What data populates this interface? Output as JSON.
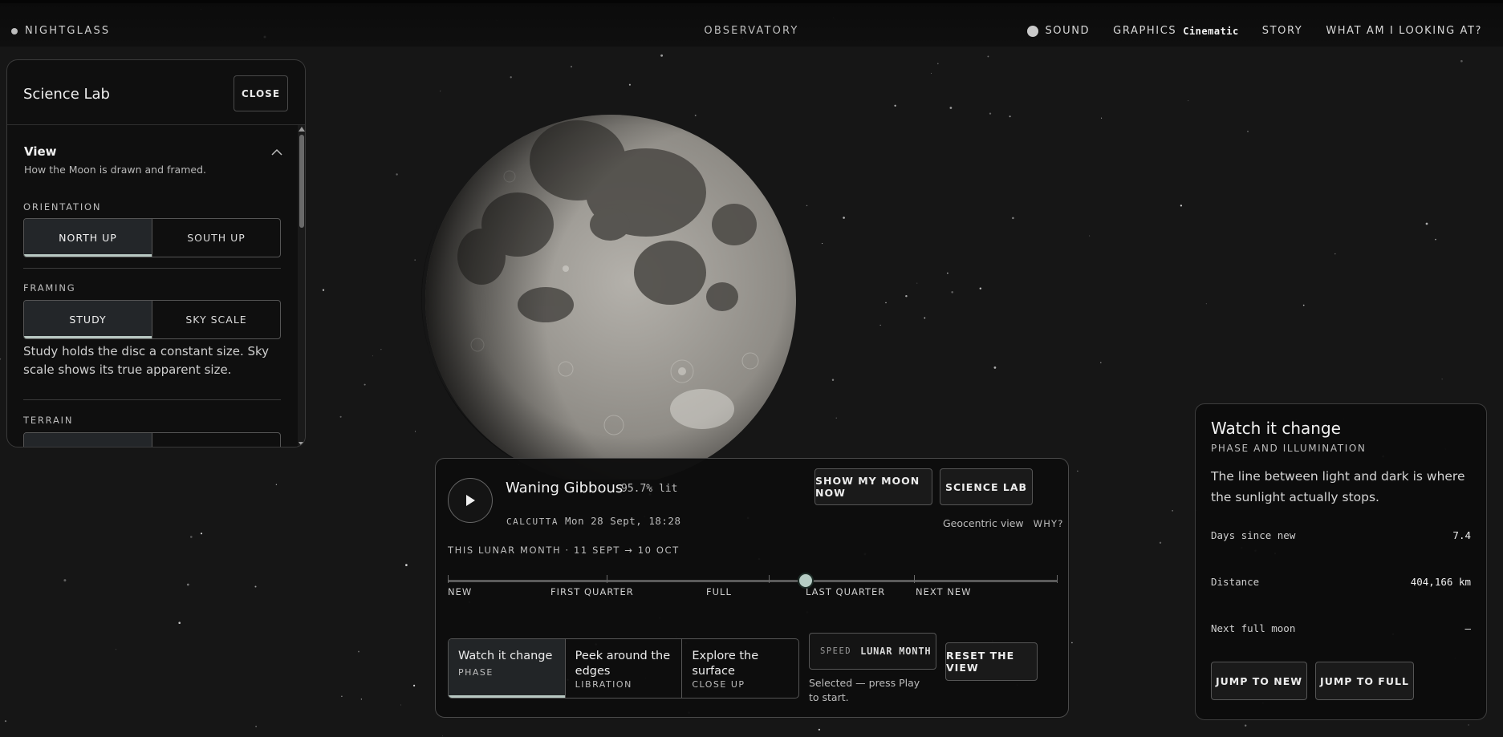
{
  "header": {
    "brand": "NIGHTGLASS",
    "center_title": "OBSERVATORY",
    "nav": {
      "sound": "SOUND",
      "graphics": "GRAPHICS",
      "graphics_value": "Cinematic",
      "story": "STORY",
      "what": "WHAT AM I LOOKING AT?"
    }
  },
  "lab": {
    "title": "Science Lab",
    "close": "CLOSE",
    "section_title": "View",
    "section_sub": "How the Moon is drawn and framed.",
    "orientation_label": "ORIENTATION",
    "orientation_options": [
      "NORTH UP",
      "SOUTH UP"
    ],
    "orientation_selected": "NORTH UP",
    "framing_label": "FRAMING",
    "framing_options": [
      "STUDY",
      "SKY SCALE"
    ],
    "framing_selected": "STUDY",
    "framing_help": "Study holds the disc a constant size. Sky scale shows its true apparent size.",
    "terrain_label": "TERRAIN"
  },
  "moon": {
    "illumination_percent": 95.7,
    "phase": "waning gibbous"
  },
  "controls": {
    "phase_name": "Waning Gibbous",
    "lit": "95.7% lit",
    "city": "CALCUTTA",
    "datetime": "Mon 28 Sept, 18:28",
    "show_moon_btn": "SHOW MY MOON NOW",
    "science_lab_btn": "SCIENCE LAB",
    "geocentric": "Geocentric view",
    "why": "WHY?",
    "month_label": "THIS LUNAR MONTH · 11 SEPT → 10 OCT",
    "timeline": {
      "labels": [
        "NEW",
        "FIRST QUARTER",
        "FULL",
        "LAST QUARTER",
        "NEXT NEW"
      ],
      "position_fraction": 0.587
    },
    "modes": [
      {
        "name": "Watch it change",
        "sub": "PHASE"
      },
      {
        "name": "Peek around the edges",
        "sub": "LIBRATION"
      },
      {
        "name": "Explore the surface",
        "sub": "CLOSE UP"
      }
    ],
    "mode_selected": "Watch it change",
    "speed_key": "SPEED",
    "speed_value": "LUNAR MONTH",
    "speed_help": "Selected — press Play to start.",
    "reset_btn": "RESET THE VIEW"
  },
  "card": {
    "title": "Watch it change",
    "subtitle": "PHASE AND ILLUMINATION",
    "description": "The line between light and dark is where the sunlight actually stops.",
    "rows": [
      {
        "label": "Days since new",
        "value": "7.4"
      },
      {
        "label": "Distance",
        "value": "404,166 km"
      },
      {
        "label": "Next full moon",
        "value": "—"
      }
    ],
    "jump_new": "JUMP TO NEW",
    "jump_full": "JUMP TO FULL"
  }
}
